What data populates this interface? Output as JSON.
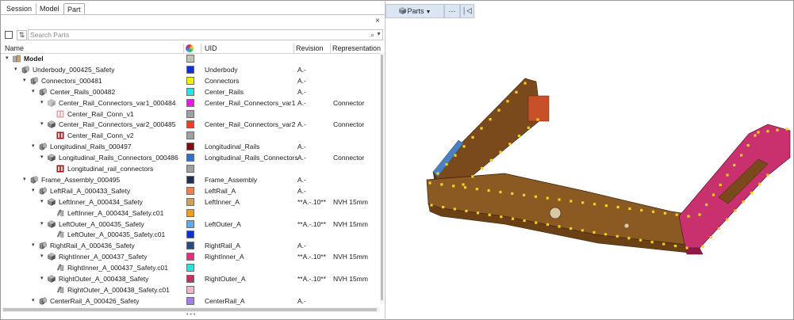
{
  "tabs": [
    {
      "label": "Session"
    },
    {
      "label": "Model"
    },
    {
      "label": "Part"
    }
  ],
  "close_glyph": "×",
  "search": {
    "placeholder": "Search Parts"
  },
  "columns": {
    "name": "Name",
    "uid": "UID",
    "revision": "Revision",
    "representation": "Representation"
  },
  "viewer": {
    "parts_label": "Parts",
    "more_label": "···",
    "pin_label": "⏐◁"
  },
  "colors": {
    "accent_tab": "#aab",
    "button_bg": "#dce6f3",
    "frame_brown": "#7a4a1c",
    "frame_magenta": "#c8306e",
    "frame_blue": "#4a7fc0",
    "weld_yellow": "#f0d020"
  },
  "rows": [
    {
      "level": 0,
      "twisty": "open",
      "icon": "model",
      "name": "Model",
      "bold": true,
      "color": "#c0c6b8",
      "uid": "",
      "rev": "",
      "rep": ""
    },
    {
      "level": 1,
      "twisty": "open",
      "icon": "assembly",
      "name": "Underbody_000425_Safety",
      "color": "#1030d0",
      "uid": "Underbody",
      "rev": "A.-",
      "rep": ""
    },
    {
      "level": 2,
      "twisty": "open",
      "icon": "assembly",
      "name": "Connectors_000481",
      "color": "#f0f000",
      "uid": "Connectors",
      "rev": "A.-",
      "rep": ""
    },
    {
      "level": 3,
      "twisty": "open",
      "icon": "assembly",
      "name": "Center_Rails_000482",
      "color": "#30e0e8",
      "uid": "Center_Rails",
      "rev": "A.-",
      "rep": ""
    },
    {
      "level": 4,
      "twisty": "open",
      "icon": "part-gray",
      "name": "Center_Rail_Connectors_var1_000484",
      "color": "#e020e0",
      "uid": "Center_Rail_Connectors_var1",
      "rev": "A.-",
      "rep": "Connector"
    },
    {
      "level": 5,
      "twisty": "",
      "icon": "connector-light",
      "name": "Center_Rail_Conn_v1",
      "color": "#a0a0a0",
      "uid": "",
      "rev": "",
      "rep": ""
    },
    {
      "level": 4,
      "twisty": "open",
      "icon": "part-dark",
      "name": "Center_Rail_Connectors_var2_000485",
      "color": "#e84020",
      "uid": "Center_Rail_Connectors_var2",
      "rev": "A.-",
      "rep": "Connector"
    },
    {
      "level": 5,
      "twisty": "",
      "icon": "connector",
      "name": "Center_Rail_Conn_v2",
      "color": "#a0a0a0",
      "uid": "",
      "rev": "",
      "rep": ""
    },
    {
      "level": 3,
      "twisty": "open",
      "icon": "assembly",
      "name": "Longitudinal_Rails_000497",
      "color": "#7a1010",
      "uid": "Longitudinal_Rails",
      "rev": "A.-",
      "rep": ""
    },
    {
      "level": 4,
      "twisty": "open",
      "icon": "part-dark",
      "name": "Longitudinal_Rails_Connectors_000486",
      "color": "#3070d0",
      "uid": "Longitudinal_Rails_Connectors",
      "rev": "A.-",
      "rep": "Connector"
    },
    {
      "level": 5,
      "twisty": "",
      "icon": "connector",
      "name": "Longitudinal_rail_connectors",
      "color": "#a0a0a0",
      "uid": "",
      "rev": "",
      "rep": ""
    },
    {
      "level": 2,
      "twisty": "open",
      "icon": "assembly",
      "name": "Frame_Assembly_000495",
      "color": "#203050",
      "uid": "Frame_Assembly",
      "rev": "A.-",
      "rep": ""
    },
    {
      "level": 3,
      "twisty": "open",
      "icon": "assembly",
      "name": "LeftRail_A_000433_Safety",
      "color": "#f08050",
      "uid": "LeftRail_A",
      "rev": "A.-",
      "rep": ""
    },
    {
      "level": 4,
      "twisty": "open",
      "icon": "part-dark",
      "name": "LeftInner_A_000434_Safety",
      "color": "#d0a060",
      "uid": "LeftInner_A",
      "rev": "**A.-.10**",
      "rep": "NVH 15mm"
    },
    {
      "level": 5,
      "twisty": "",
      "icon": "subpart",
      "name": "LeftInner_A_000434_Safety.c01",
      "color": "#f0a020",
      "uid": "",
      "rev": "",
      "rep": ""
    },
    {
      "level": 4,
      "twisty": "open",
      "icon": "part-dark",
      "name": "LeftOuter_A_000435_Safety",
      "color": "#60a8e8",
      "uid": "LeftOuter_A",
      "rev": "**A.-.10**",
      "rep": "NVH 15mm"
    },
    {
      "level": 5,
      "twisty": "",
      "icon": "subpart",
      "name": "LeftOuter_A_000435_Safety.c01",
      "color": "#1030d0",
      "uid": "",
      "rev": "",
      "rep": ""
    },
    {
      "level": 3,
      "twisty": "open",
      "icon": "assembly",
      "name": "RightRail_A_000436_Safety",
      "color": "#2a4a80",
      "uid": "RightRail_A",
      "rev": "A.-",
      "rep": ""
    },
    {
      "level": 4,
      "twisty": "open",
      "icon": "part-dark",
      "name": "RightInner_A_000437_Safety",
      "color": "#e03080",
      "uid": "RightInner_A",
      "rev": "**A.-.10**",
      "rep": "NVH 15mm"
    },
    {
      "level": 5,
      "twisty": "",
      "icon": "subpart",
      "name": "RightInner_A_000437_Safety.c01",
      "color": "#30e0e0",
      "uid": "",
      "rev": "",
      "rep": ""
    },
    {
      "level": 4,
      "twisty": "open",
      "icon": "part-dark",
      "name": "RightOuter_A_000438_Safety",
      "color": "#c03060",
      "uid": "RightOuter_A",
      "rev": "**A.-.10**",
      "rep": "NVH 15mm"
    },
    {
      "level": 5,
      "twisty": "",
      "icon": "subpart",
      "name": "RightOuter_A_000438_Safety.c01",
      "color": "#f0b8c8",
      "uid": "",
      "rev": "",
      "rep": ""
    },
    {
      "level": 3,
      "twisty": "open",
      "icon": "assembly",
      "name": "CenterRail_A_000426_Safety",
      "color": "#a080e0",
      "uid": "CenterRail_A",
      "rev": "A.-",
      "rep": ""
    }
  ]
}
